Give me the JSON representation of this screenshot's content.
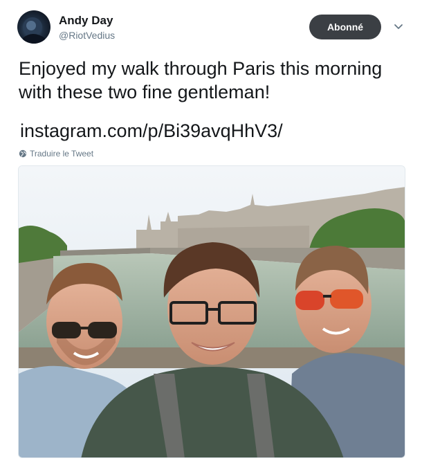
{
  "tweet": {
    "author": {
      "name": "Andy Day",
      "handle": "@RiotVedius"
    },
    "follow_button_label": "Abonné",
    "text_lines": [
      "Enjoyed my walk through Paris this morning",
      "with these two fine gentleman!"
    ],
    "link": "instagram.com/p/Bi39avqHhV3/",
    "translate_label": "Traduire le Tweet",
    "colors": {
      "follow_button_bg": "#3b3f44",
      "secondary_text": "#657786",
      "primary_text": "#14171a"
    },
    "icons": {
      "more": "chevron-down-icon",
      "translate": "globe-icon"
    }
  }
}
